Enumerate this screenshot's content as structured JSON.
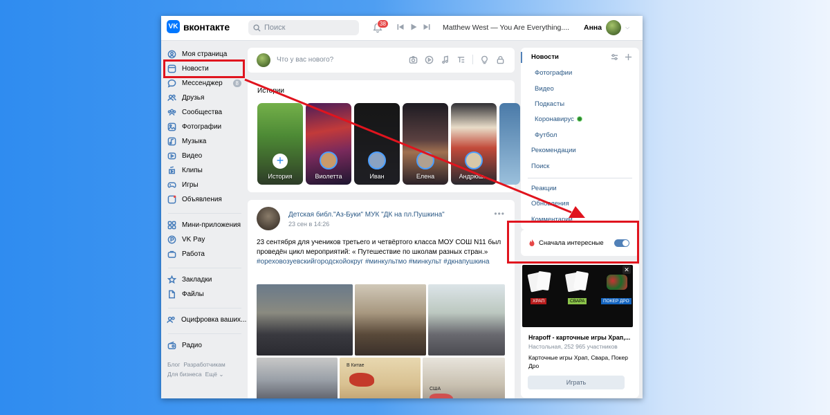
{
  "header": {
    "logo": "вконтакте",
    "logo_mark": "VK",
    "search_placeholder": "Поиск",
    "notification_count": "38",
    "now_playing": "Matthew West — You Are Everything....",
    "user_name": "Анна",
    "icons": [
      "search-icon",
      "bell-icon",
      "prev-icon",
      "play-icon",
      "next-icon",
      "chevron-down-icon"
    ]
  },
  "nav": {
    "items": [
      {
        "label": "Моя страница",
        "icon": "user-icon"
      },
      {
        "label": "Новости",
        "icon": "news-icon"
      },
      {
        "label": "Мессенджер",
        "icon": "message-icon",
        "count": "8"
      },
      {
        "label": "Друзья",
        "icon": "friends-icon"
      },
      {
        "label": "Сообщества",
        "icon": "communities-icon"
      },
      {
        "label": "Фотографии",
        "icon": "photo-icon"
      },
      {
        "label": "Музыка",
        "icon": "music-icon"
      },
      {
        "label": "Видео",
        "icon": "video-icon"
      },
      {
        "label": "Клипы",
        "icon": "clips-icon"
      },
      {
        "label": "Игры",
        "icon": "games-icon"
      },
      {
        "label": "Объявления",
        "icon": "ads-icon"
      },
      {
        "label": "Мини-приложения",
        "icon": "apps-icon"
      },
      {
        "label": "VK Pay",
        "icon": "vkpay-icon"
      },
      {
        "label": "Работа",
        "icon": "work-icon"
      },
      {
        "label": "Закладки",
        "icon": "bookmark-icon"
      },
      {
        "label": "Файлы",
        "icon": "files-icon"
      },
      {
        "label": "Оцифровка ваших...",
        "icon": "digitize-icon"
      },
      {
        "label": "Радио",
        "icon": "radio-icon"
      }
    ],
    "footer": [
      "Блог",
      "Разработчикам",
      "Для бизнеса",
      "Ещё ⌄"
    ]
  },
  "compose": {
    "placeholder": "Что у вас нового?"
  },
  "stories": {
    "title": "Истории",
    "items": [
      "История",
      "Виолетта",
      "Иван",
      "Елена",
      "Андрюш..."
    ]
  },
  "post": {
    "author": "Детская библ.\"Аз-Буки\" МУК \"ДК на пл.Пушкина\"",
    "date": "23 сен в 14:26",
    "text": "23 сентября для учеников третьего и четвёртого класса МОУ СОШ N11 был проведён цикл мероприятий: « Путешествие по школам разных стран.»",
    "tags": "#ореховозуевскийгородскойокруг #минкультмо #минкульт #дкнапушкина",
    "photo_captions": [
      "В Китае",
      "США"
    ]
  },
  "right_nav": {
    "title": "Новости",
    "sub_items": [
      "Фотографии",
      "Видео",
      "Подкасты",
      "Коронавирус",
      "Футбол"
    ],
    "main_items": [
      "Рекомендации",
      "Поиск"
    ],
    "bottom_items": [
      "Реакции",
      "Обновления",
      "Комментарии"
    ]
  },
  "toggle": {
    "label": "Сначала интересные",
    "enabled": true
  },
  "ad": {
    "title": "Hrapoff - карточные игры Храп,...",
    "subtitle": "Настольная, 252 965 участников",
    "description": "Карточные игры Храп, Свара, Покер Дро",
    "button": "Играть",
    "banner_labels": [
      "ХРАП",
      "СВАРА",
      "ПОКЕР ДРО"
    ]
  },
  "colors": {
    "accent": "#0077ff",
    "link": "#2a5885",
    "highlight": "#e0141e",
    "background": "#edeef0"
  }
}
